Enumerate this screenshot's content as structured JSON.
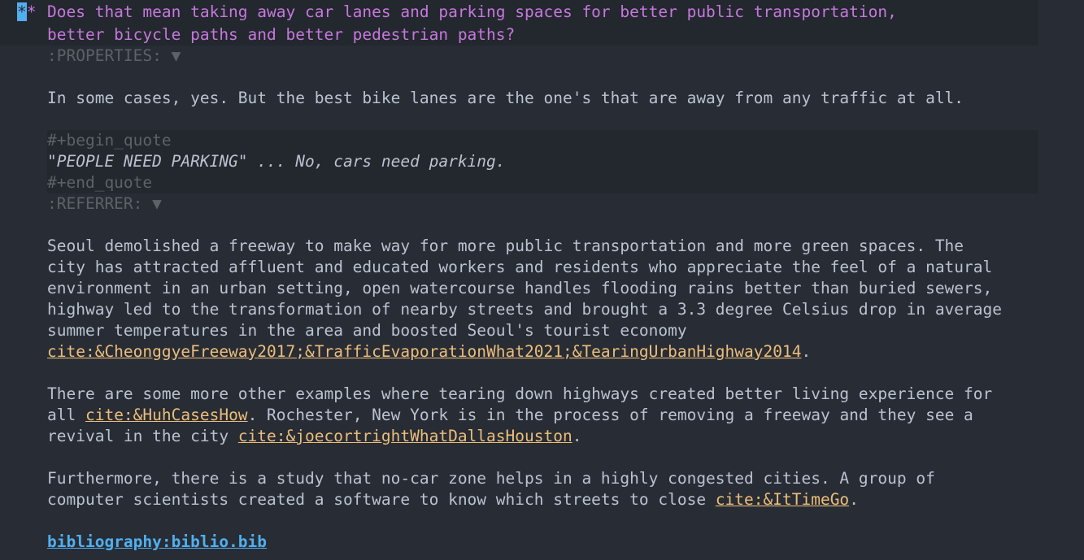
{
  "heading": {
    "stars_cursor": "*",
    "stars_rest": "*",
    "line1": "Does that mean taking away car lanes and parking spaces for better public transportation,",
    "line2": "better bicycle paths and better pedestrian paths?"
  },
  "properties_drawer": ":PROPERTIES: ▼",
  "intro": "In some cases, yes. But the best bike lanes are the one's that are away from any traffic at all.",
  "quote": {
    "begin": "#+begin_quote",
    "text": "\"PEOPLE NEED PARKING\" ... No, cars need parking.",
    "end": "#+end_quote"
  },
  "referrer_drawer": ":REFERRER: ▼",
  "para1": {
    "l1": "Seoul demolished a freeway to make way for more public transportation and more green spaces. The",
    "l2": "city has attracted affluent and educated workers and residents who appreciate the feel of a natural",
    "l3": "environment in an urban setting, open watercourse handles flooding rains better than buried sewers,",
    "l4": "highway led to the transformation of nearby streets and brought a 3.3 degree Celsius drop in average",
    "l5": "summer temperatures in the area and boosted Seoul's tourist economy",
    "cite": "cite:&CheonggyeFreeway2017;&TrafficEvaporationWhat2021;&TearingUrbanHighway2014",
    "after": "."
  },
  "para2": {
    "l1": "There are some more other examples where tearing down highways created better living experience for",
    "l2_before": "all ",
    "l2_cite": "cite:&HuhCasesHow",
    "l2_after": ". Rochester, New York is in the process of removing a freeway and they see a",
    "l3_before": "revival in the city ",
    "l3_cite": "cite:&joecortrightWhatDallasHouston",
    "l3_after": "."
  },
  "para3": {
    "l1": "Furthermore, there is a study that no-car zone helps in a highly congested cities. A group of",
    "l2_before": "computer scientists created a software to know which streets to close ",
    "l2_cite": "cite:&ItTimeGo",
    "l2_after": "."
  },
  "bibliography": "bibliography:biblio.bib"
}
